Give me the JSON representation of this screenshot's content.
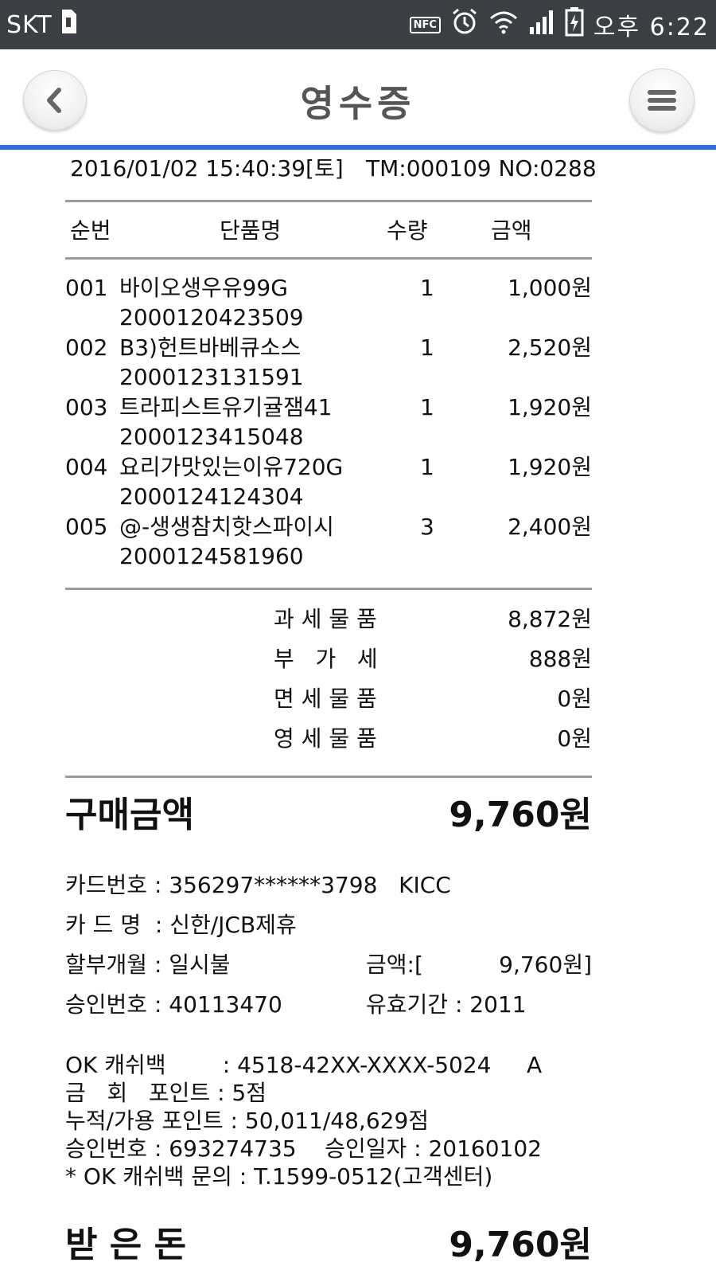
{
  "status_bar": {
    "carrier": "SKT",
    "nfc": "NFC",
    "time": "오후 6:22"
  },
  "header": {
    "title": "영수증"
  },
  "receipt": {
    "datetime": "2016/01/02 15:40:39[토]",
    "terminal": "TM:000109 NO:0288",
    "columns": [
      "순번",
      "단품명",
      "수량",
      "금액"
    ],
    "items": [
      {
        "no": "001",
        "name": "바이오생우유99G",
        "barcode": "2000120423509",
        "qty": "1",
        "amount": "1,000원"
      },
      {
        "no": "002",
        "name": "B3)헌트바베큐소스",
        "barcode": "2000123131591",
        "qty": "1",
        "amount": "2,520원"
      },
      {
        "no": "003",
        "name": "트라피스트유기귤잼41",
        "barcode": "2000123415048",
        "qty": "1",
        "amount": "1,920원"
      },
      {
        "no": "004",
        "name": "요리가맛있는이유720G",
        "barcode": "2000124124304",
        "qty": "1",
        "amount": "1,920원"
      },
      {
        "no": "005",
        "name": "@-생생참치핫스파이시",
        "barcode": "2000124581960",
        "qty": "3",
        "amount": "2,400원"
      }
    ],
    "summary": [
      {
        "label": "과 세 물 품",
        "value": "8,872원"
      },
      {
        "label": "부   가   세",
        "value": "888원"
      },
      {
        "label": "면 세 물 품",
        "value": "0원"
      },
      {
        "label": "영 세 물 품",
        "value": "0원"
      }
    ],
    "purchase_total_label": "구매금액",
    "purchase_total_value": "9,760원",
    "card": {
      "number": "카드번호 : 356297******3798   KICC",
      "name": "카 드 명  : 신한/JCB제휴",
      "installment": "할부개월 : 일시불",
      "amount_label": "금액:[",
      "amount_value": "9,760원]",
      "approval": "승인번호 : 40113470",
      "validity": "유효기간 : 2011"
    },
    "okcashbag": [
      "OK 캐쉬백        : 4518-42XX-XXXX-5024     A",
      "금   회   포인트 : 5점",
      "누적/가용 포인트 : 50,011/48,629점",
      "승인번호 : 693274735    승인일자 : 20160102",
      "* OK 캐쉬백 문의 : T.1599-0512(고객센터)"
    ],
    "received_label": "받 은 돈",
    "received_value": "9,760원"
  },
  "colors": {
    "status_bar_bg": "#3b3f44",
    "accent_line": "#2f6fd6",
    "title_text": "#555555"
  },
  "icons": [
    "sim-icon",
    "nfc-icon",
    "alarm-icon",
    "wifi-icon",
    "signal-icon",
    "battery-icon",
    "back-arrow-icon",
    "menu-icon"
  ]
}
